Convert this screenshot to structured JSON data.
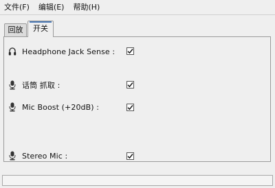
{
  "menubar": {
    "items": [
      {
        "label": "文件(F)"
      },
      {
        "label": "编辑(E)"
      },
      {
        "label": "帮助(H)"
      }
    ]
  },
  "tabs": [
    {
      "label": "回放",
      "active": false
    },
    {
      "label": "开关",
      "active": true
    }
  ],
  "switches": [
    {
      "label": "Headphone Jack Sense :",
      "icon": "headphones-icon",
      "checked": true
    },
    {
      "label": "话筒 抓取 :",
      "icon": "microphone-icon",
      "checked": true
    },
    {
      "label": "Mic Boost (+20dB) :",
      "icon": "microphone-icon",
      "checked": true
    },
    {
      "label": "Stereo Mic :",
      "icon": "microphone-icon",
      "checked": true
    }
  ],
  "statusbar": {
    "text": ""
  }
}
